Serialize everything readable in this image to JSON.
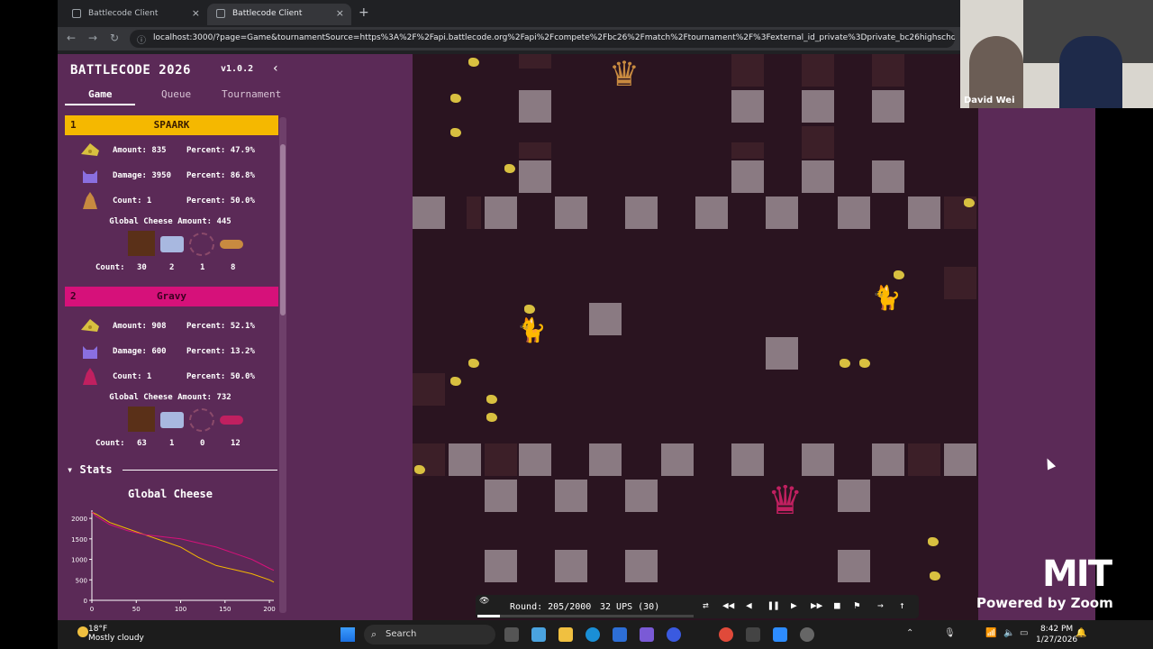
{
  "browser": {
    "tabs": [
      {
        "label": "Battlecode Client",
        "active": false
      },
      {
        "label": "Battlecode Client",
        "active": true
      }
    ],
    "new_tab": "+",
    "url": "localhost:3000/?page=Game&tournamentSource=https%3A%2F%2Fapi.battlecode.org%2Fapi%2Fcompete%2Fbc26%2Fmatch%2Ftournament%2F%3Fexternal_id_private%3Dprivate_bc26highschool_854211c9_d..."
  },
  "sidebar": {
    "title": "BATTLECODE 2026",
    "version": "v1.0.2",
    "collapse_icon": "‹",
    "tabs": [
      "Game",
      "Queue",
      "Tournament"
    ],
    "teams": [
      {
        "rank": "1",
        "name": "SPAARK",
        "color": "#f5b800",
        "amount_line": "Amount: 835",
        "amount_pct": "Percent: 47.9%",
        "damage_line": "Damage: 3950",
        "damage_pct": "Percent: 86.8%",
        "count_line": "Count: 1",
        "count_pct": "Percent: 50.0%",
        "global_cheese": "Global Cheese Amount: 445",
        "unit_counts": [
          "30",
          "2",
          "1",
          "8"
        ]
      },
      {
        "rank": "2",
        "name": "Gravy",
        "color": "#d6117a",
        "amount_line": "Amount: 908",
        "amount_pct": "Percent: 52.1%",
        "damage_line": "Damage: 600",
        "damage_pct": "Percent: 13.2%",
        "count_line": "Count: 1",
        "count_pct": "Percent: 50.0%",
        "global_cheese": "Global Cheese Amount: 732",
        "unit_counts": [
          "63",
          "1",
          "0",
          "12"
        ]
      }
    ],
    "count_label": "Count:",
    "stats_header": "Stats",
    "stats_toggle_icon": "▾"
  },
  "chart_data": {
    "type": "line",
    "title": "Global Cheese",
    "xlabel": "",
    "ylabel": "",
    "xlim": [
      0,
      205
    ],
    "ylim": [
      0,
      2200
    ],
    "x_ticks": [
      0,
      50,
      100,
      150,
      200
    ],
    "y_ticks": [
      0,
      500,
      1000,
      1500,
      2000
    ],
    "series": [
      {
        "color": "#f5b800",
        "x": [
          0,
          5,
          20,
          40,
          60,
          80,
          100,
          120,
          140,
          160,
          180,
          200,
          205
        ],
        "y": [
          2150,
          2100,
          1900,
          1750,
          1600,
          1450,
          1300,
          1050,
          850,
          750,
          650,
          500,
          445
        ]
      },
      {
        "color": "#d6117a",
        "x": [
          0,
          5,
          20,
          40,
          60,
          80,
          100,
          120,
          140,
          160,
          180,
          200,
          205
        ],
        "y": [
          2150,
          2050,
          1850,
          1700,
          1600,
          1550,
          1500,
          1400,
          1300,
          1150,
          1000,
          780,
          732
        ]
      }
    ]
  },
  "controls": {
    "round_text": "Round: 205/2000",
    "ups_text": "32 UPS (30)",
    "progress": 0.1025,
    "buttons": [
      "⇄",
      "◀◀",
      "◀",
      "❚❚",
      "▶",
      "▶▶",
      "■",
      "⚑",
      "→",
      "↑"
    ]
  },
  "zoom": {
    "participant_name": "David Wei",
    "logo": "MIT",
    "powered_by": "Powered by Zoom"
  },
  "taskbar": {
    "temperature": "18°F",
    "weather": "Mostly cloudy",
    "search_placeholder": "Search",
    "time": "8:42 PM",
    "date": "1/27/2026"
  }
}
